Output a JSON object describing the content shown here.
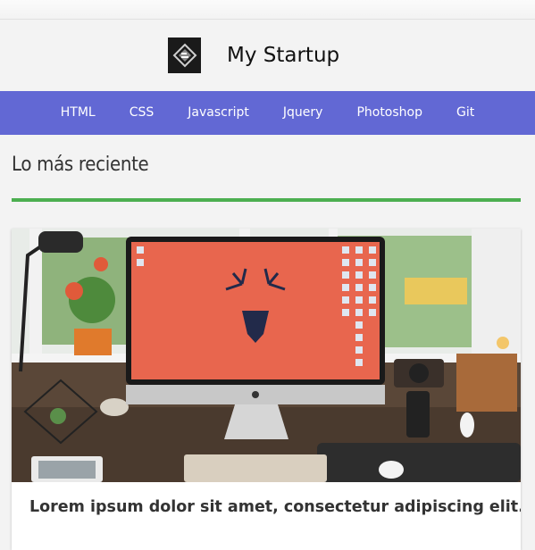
{
  "header": {
    "brand": "My Startup"
  },
  "nav": {
    "items": [
      "HTML",
      "CSS",
      "Javascript",
      "Jquery",
      "Photoshop",
      "Git"
    ]
  },
  "section": {
    "title": "Lo más reciente"
  },
  "article": {
    "title": "Lorem ipsum dolor sit amet, consectetur adipiscing elit."
  },
  "colors": {
    "nav": "#6268d4",
    "rule": "#4caf50",
    "screen": "#e8664e"
  }
}
